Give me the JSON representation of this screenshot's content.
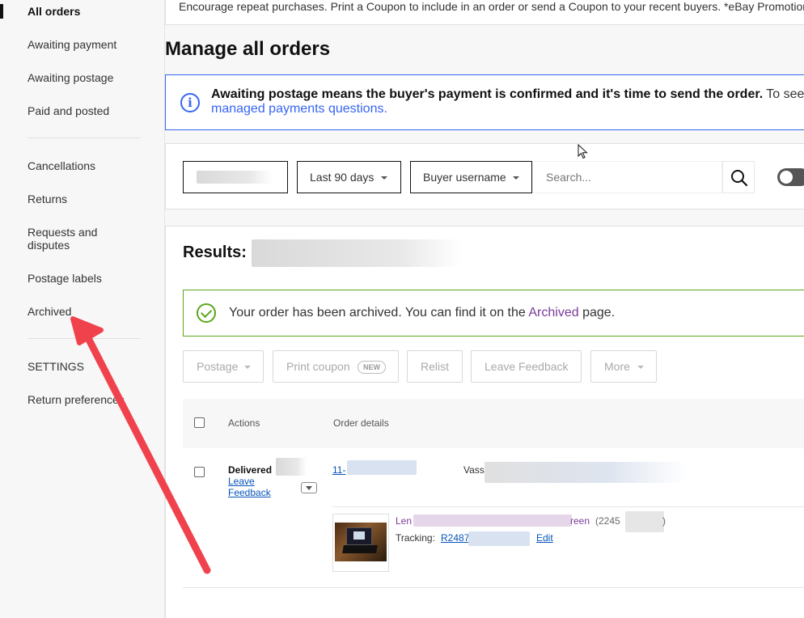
{
  "sidebar": {
    "items": [
      {
        "label": "All orders"
      },
      {
        "label": "Awaiting payment"
      },
      {
        "label": "Awaiting postage"
      },
      {
        "label": "Paid and posted"
      },
      {
        "label": "Cancellations"
      },
      {
        "label": "Returns"
      },
      {
        "label": "Requests and\ndisputes"
      },
      {
        "label": "Postage labels"
      },
      {
        "label": "Archived"
      }
    ],
    "settings_heading": "SETTINGS",
    "settings_items": [
      {
        "label": "Return preferences"
      }
    ]
  },
  "promo": {
    "text": "Encourage repeat purchases. Print a Coupon to include in an order or send a Coupon to your recent buyers. *eBay Promotions"
  },
  "page_title": "Manage all orders",
  "info": {
    "bold_text": "Awaiting postage means the buyer's payment is confirmed and it's time to send the order.",
    "rest_text": "To see",
    "link_text": "managed payments questions."
  },
  "filters": {
    "date_range": "Last 90 days",
    "search_by": "Buyer username",
    "search_placeholder": "Search..."
  },
  "results": {
    "label": "Results:"
  },
  "success": {
    "prefix": "Your order has been archived. You can find it on the",
    "link": "Archived",
    "suffix": "page."
  },
  "actions": {
    "postage": "Postage",
    "print_coupon": "Print coupon",
    "new_badge": "NEW",
    "relist": "Relist",
    "leave_feedback": "Leave Feedback",
    "more": "More"
  },
  "table": {
    "col_actions": "Actions",
    "col_order_details": "Order details"
  },
  "order": {
    "status": "Delivered",
    "leave_link": "Leave",
    "feedback_link": "Feedback",
    "order_no_prefix": "11-",
    "buyer_prefix": "Vass",
    "item_prefix": "Len",
    "item_suffix": "reen",
    "item_id_prefix": "(2245",
    "item_id_suffix": ")",
    "tracking_label": "Tracking:",
    "tracking_prefix": "R2487",
    "edit_link": "Edit"
  },
  "colors": {
    "accent": "#3665f3",
    "success": "#5ba71b",
    "link": "#0654ba",
    "visited": "#7a3b9a",
    "annotation_arrow": "#f0424d"
  }
}
